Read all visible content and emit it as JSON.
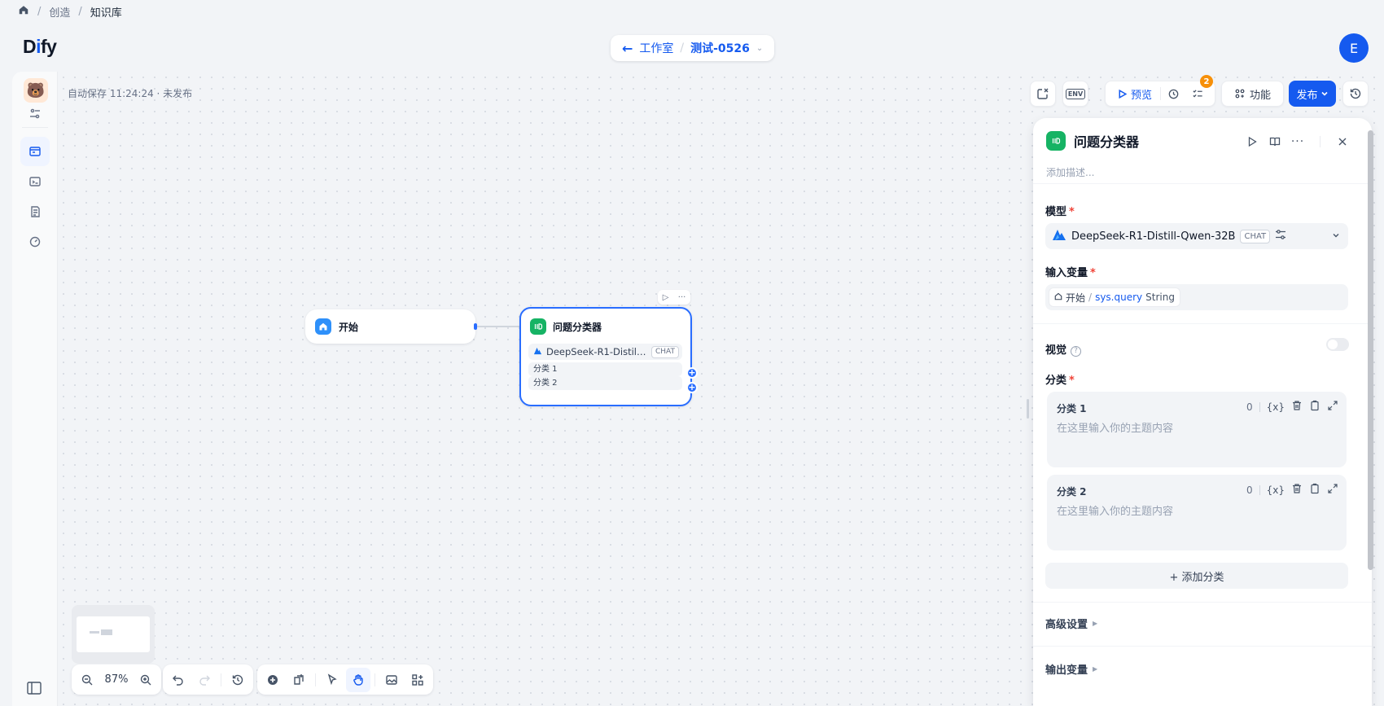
{
  "breadcrumb": {
    "items": [
      "创造",
      "知识库"
    ]
  },
  "header": {
    "logo_pre": "D",
    "logo_i": "i",
    "logo_post": "fy",
    "back_label": "工作室",
    "app_name": "测试-0526",
    "avatar_letter": "E"
  },
  "canvas": {
    "autosave": "自动保存 11:24:24 · 未发布"
  },
  "toolbar": {
    "env_label": "ENV",
    "preview_label": "预览",
    "badge_count": "2",
    "features_label": "功能",
    "publish_label": "发布",
    "accent_color": "#155aef"
  },
  "nodes": {
    "start": {
      "title": "开始"
    },
    "classifier": {
      "title": "问题分类器",
      "model": "DeepSeek-R1-Distill-...",
      "model_tag": "CHAT",
      "classes": [
        "分类 1",
        "分类 2"
      ]
    }
  },
  "bottom_toolbar": {
    "zoom": "87%"
  },
  "panel": {
    "title": "问题分类器",
    "description_placeholder": "添加描述...",
    "model_label": "模型",
    "model_name": "DeepSeek-R1-Distill-Qwen-32B",
    "model_tag": "CHAT",
    "input_label": "输入变量",
    "var_node": "开始",
    "var_path": "sys.query",
    "var_type": "String",
    "vision_label": "视觉",
    "vision_enabled": false,
    "classes_label": "分类",
    "classes": [
      {
        "name": "分类 1",
        "count": "0",
        "placeholder": "在这里输入你的主题内容"
      },
      {
        "name": "分类 2",
        "count": "0",
        "placeholder": "在这里输入你的主题内容"
      }
    ],
    "var_icon": "{x}",
    "add_class_label": "+ 添加分类",
    "advanced_label": "高级设置",
    "output_label": "输出变量"
  }
}
